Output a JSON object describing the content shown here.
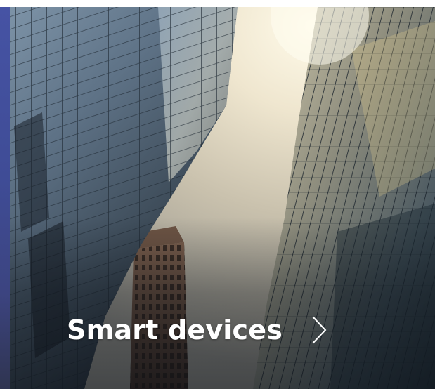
{
  "card": {
    "title": "Smart devices",
    "arrow_icon": "chevron-right-icon",
    "image_subject": "city-skyscrapers-photo"
  },
  "colors": {
    "text": "#ffffff",
    "left_strip": "#4653a4",
    "background": "#ffffff"
  }
}
